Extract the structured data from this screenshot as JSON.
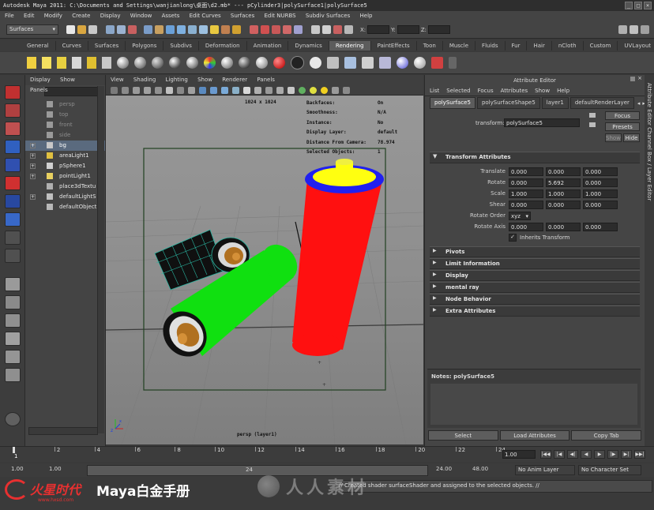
{
  "window": {
    "title": "Autodesk Maya 2011: C:\\Documents and Settings\\wanjianlong\\桌面\\d2.mb*   ---   pCylinder3|polySurface1|polySurface5",
    "buttons": [
      "_",
      "□",
      "×"
    ]
  },
  "menubar": [
    "File",
    "Edit",
    "Modify",
    "Create",
    "Display",
    "Window",
    "Assets",
    "Edit Curves",
    "Surfaces",
    "Edit NURBS",
    "Subdiv Surfaces",
    "Help"
  ],
  "status_line": {
    "menuset": "Surfaces",
    "field_prefix": "X:",
    "fields": [
      "Y:",
      "Z:"
    ]
  },
  "shelf": {
    "tabs": [
      "General",
      "Curves",
      "Surfaces",
      "Polygons",
      "Subdivs",
      "Deformation",
      "Animation",
      "Dynamics",
      "Rendering",
      "PaintEffects",
      "Toon",
      "Muscle",
      "Fluids",
      "Fur",
      "Hair",
      "nCloth",
      "Custom",
      "UVLayout"
    ],
    "active_tab": "Rendering"
  },
  "outliner": {
    "menu": [
      "Display",
      "Show",
      "Panels"
    ],
    "items": [
      {
        "name": "persp",
        "expand": "",
        "dim": true,
        "selected": false
      },
      {
        "name": "top",
        "expand": "",
        "dim": true,
        "selected": false
      },
      {
        "name": "front",
        "expand": "",
        "dim": true,
        "selected": false
      },
      {
        "name": "side",
        "expand": "",
        "dim": true,
        "selected": false
      },
      {
        "name": "bg",
        "expand": "+",
        "dim": false,
        "selected": true
      },
      {
        "name": "areaLight1",
        "expand": "+",
        "dim": false,
        "selected": false
      },
      {
        "name": "pSphere1",
        "expand": "+",
        "dim": false,
        "selected": false
      },
      {
        "name": "pointLight1",
        "expand": "+",
        "dim": false,
        "selected": false
      },
      {
        "name": "place3dTextu",
        "expand": "",
        "dim": false,
        "selected": false
      },
      {
        "name": "defaultLightS",
        "expand": "+",
        "dim": false,
        "selected": false
      },
      {
        "name": "defaultObject",
        "expand": "",
        "dim": false,
        "selected": false
      }
    ]
  },
  "viewport": {
    "menu": [
      "View",
      "Shading",
      "Lighting",
      "Show",
      "Renderer",
      "Panels"
    ],
    "resolution": "1024 x 1024",
    "camera_label": "persp (layer1)",
    "hud": [
      {
        "label": "Backfaces:",
        "value": "On"
      },
      {
        "label": "Smoothness:",
        "value": "N/A"
      },
      {
        "label": "Instance:",
        "value": "No"
      },
      {
        "label": "Display Layer:",
        "value": "default"
      },
      {
        "label": "Distance From Camera:",
        "value": "78.974"
      },
      {
        "label": "Selected Objects:",
        "value": "1"
      }
    ]
  },
  "attribute_editor": {
    "title": "Attribute Editor",
    "menu": [
      "List",
      "Selected",
      "Focus",
      "Attributes",
      "Show",
      "Help"
    ],
    "tabs": [
      "polySurface5",
      "polySurfaceShape5",
      "layer1",
      "defaultRenderLayer"
    ],
    "active_tab": "polySurface5",
    "transform_label": "transform:",
    "transform_value": "polySurface5",
    "focus_button": "Focus",
    "presets_button": "Presets",
    "show_button": "Show",
    "hide_button": "Hide",
    "section_title": "Transform Attributes",
    "rows": [
      {
        "label": "Translate",
        "values": [
          "0.000",
          "0.000",
          "0.000"
        ]
      },
      {
        "label": "Rotate",
        "values": [
          "0.000",
          "5.692",
          "0.000"
        ]
      },
      {
        "label": "Scale",
        "values": [
          "1.000",
          "1.000",
          "1.000"
        ]
      },
      {
        "label": "Shear",
        "values": [
          "0.000",
          "0.000",
          "0.000"
        ]
      }
    ],
    "rotate_order_label": "Rotate Order",
    "rotate_order_value": "xyz",
    "rotate_axis_label": "Rotate Axis",
    "rotate_axis_values": [
      "0.000",
      "0.000",
      "0.000"
    ],
    "inherits_label": "Inherits Transform",
    "inherits_checked": true,
    "collapsed_sections": [
      "Pivots",
      "Limit Information",
      "Display",
      "mental ray",
      "Node Behavior",
      "Extra Attributes"
    ],
    "notes_label": "Notes: polySurface5",
    "footer_buttons": [
      "Select",
      "Load Attributes",
      "Copy Tab"
    ],
    "side_tabs": "Attribute Editor    Channel Box / Layer Editor"
  },
  "timeline": {
    "ticks": [
      "2",
      "4",
      "6",
      "8",
      "10",
      "12",
      "14",
      "16",
      "18",
      "20",
      "22",
      "24"
    ],
    "current_frame": "1",
    "frame_field": "1.00",
    "start": "1.00",
    "playback_start": "1.00",
    "playback_end": "24.00",
    "end": "48.00",
    "range_marker": "24",
    "anim_layer": "No Anim Layer",
    "character_set": "No Character Set",
    "playback_buttons": [
      "|◀◀",
      "|◀",
      "◀|",
      "◀",
      "▶",
      "|▶",
      "▶|",
      "▶▶|"
    ]
  },
  "command_line": {
    "response": "// Created shader surfaceShader and assigned to the selected objects. //"
  },
  "watermark": {
    "brand": "火星时代",
    "url": "www.hxsd.com",
    "title": "Maya白金手册",
    "overlay": "人人素材"
  }
}
